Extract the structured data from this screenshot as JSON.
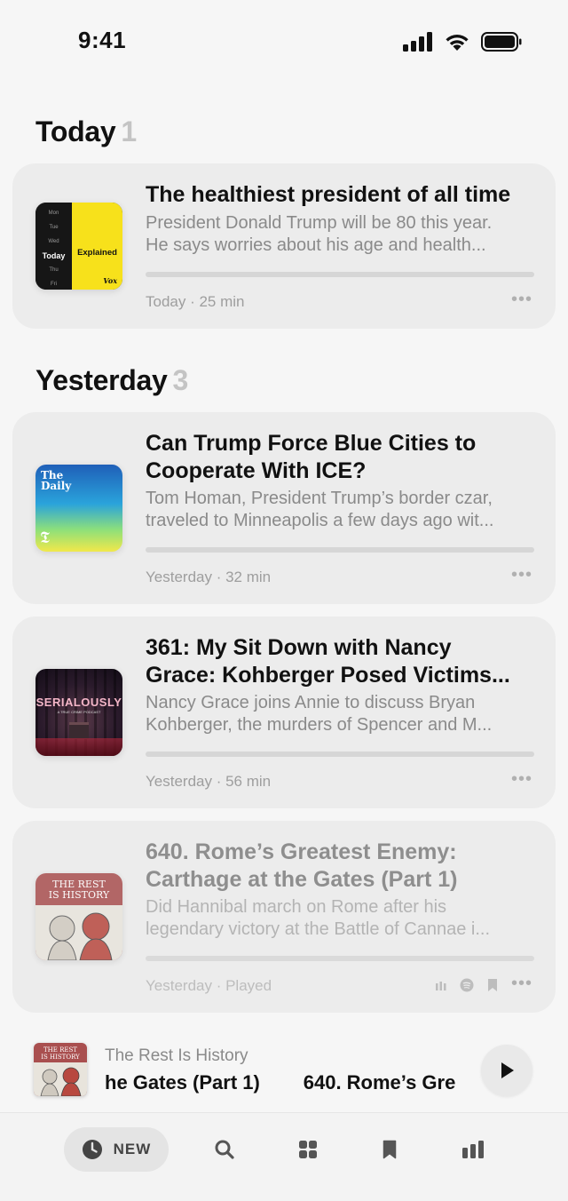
{
  "status_bar": {
    "time": "9:41"
  },
  "sections": {
    "today": {
      "title": "Today",
      "count": "1"
    },
    "yesterday": {
      "title": "Yesterday",
      "count": "3"
    }
  },
  "episodes": [
    {
      "title": "The healthiest president of all time",
      "desc_lines": [
        "President Donald Trump will be 80 this year.",
        "He says worries about his age and health..."
      ],
      "meta": "Today · 25 min",
      "progress": 0,
      "art": {
        "days": [
          "Mon",
          "Tue",
          "Wed",
          "Today",
          "Thu",
          "Fri"
        ],
        "name": "Explained",
        "brand": "Vox",
        "color": "#f7e11b"
      }
    },
    {
      "title_lines": [
        "Can Trump Force Blue Cities to",
        "Cooperate With ICE?"
      ],
      "desc_lines": [
        "Tom Homan, President Trump’s border czar,",
        "traveled to Minneapolis a few days ago wit..."
      ],
      "meta": "Yesterday · 32 min",
      "progress": 0,
      "art": {
        "name_line1": "The",
        "name_line2": "Daily",
        "monogram": "𝕿"
      }
    },
    {
      "title_lines": [
        "361: My Sit Down with Nancy",
        "Grace: Kohberger Posed Victims..."
      ],
      "desc_lines": [
        "Nancy Grace joins Annie to discuss Bryan",
        "Kohberger, the murders of Spencer and M..."
      ],
      "meta": "Yesterday · 56 min",
      "progress": 0,
      "art": {
        "name": "SERIALOUSLY",
        "tagline": "A TRUE CRIME PODCAST"
      }
    },
    {
      "title_lines": [
        "640. Rome’s Greatest Enemy:",
        "Carthage at the Gates (Part 1)"
      ],
      "desc_lines": [
        "Did Hannibal march on Rome after his",
        "legendary victory at the Battle of Cannae i..."
      ],
      "meta": "Yesterday · Played",
      "progress": 1,
      "art": {
        "line1": "THE REST",
        "line2": "IS HISTORY"
      }
    }
  ],
  "mini_player": {
    "show": "The Rest Is History",
    "episode_scroll": "he Gates (Part 1)        640. Rome’s Gre",
    "art": {
      "line1": "THE REST",
      "line2": "IS HISTORY"
    }
  },
  "tab_bar": {
    "active_tab": "new",
    "new_label": "NEW",
    "tabs": [
      "new",
      "search",
      "library",
      "saved",
      "charts"
    ]
  },
  "colors": {
    "background": "#f6f6f6",
    "card": "#ececec",
    "secondary_text": "#8a8a8a"
  }
}
